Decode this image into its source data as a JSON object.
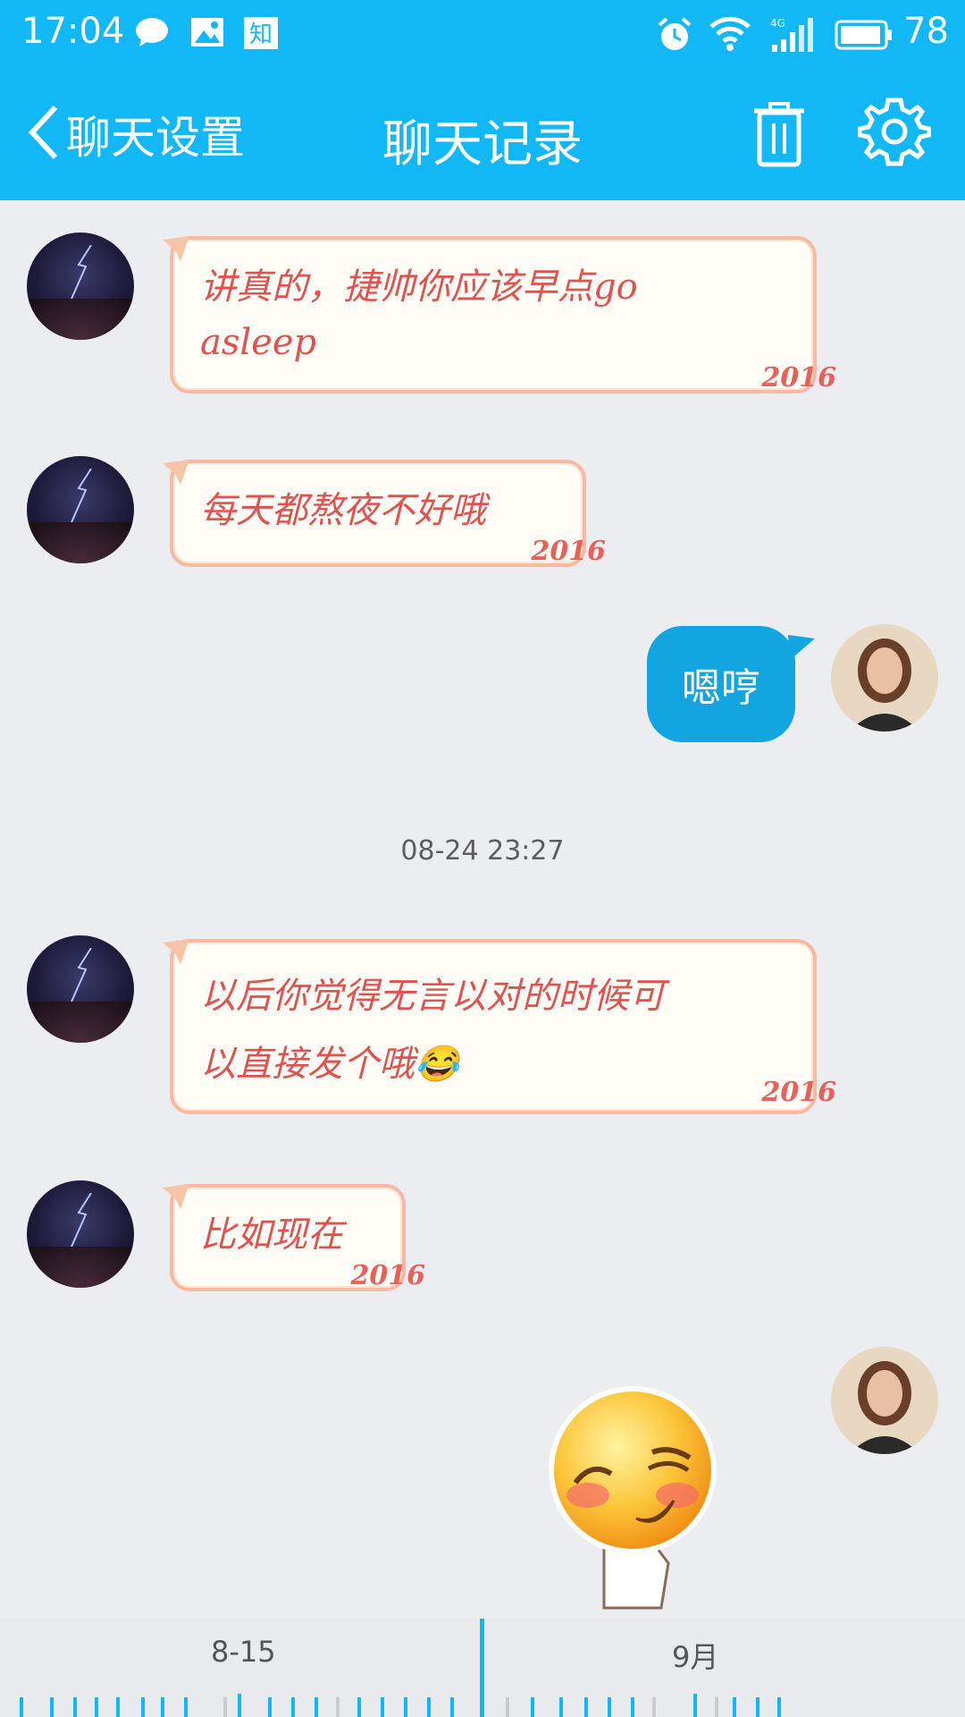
{
  "status_bar": {
    "time": "17:04",
    "battery": "78",
    "network": "4G"
  },
  "header": {
    "back_label": "聊天设置",
    "title": "聊天记录"
  },
  "messages": [
    {
      "side": "left",
      "text_line1": "讲真的，捷帅你应该早点go",
      "text_line2": "asleep",
      "badge": "2016"
    },
    {
      "side": "left",
      "text": "每天都熬夜不好哦",
      "badge": "2016"
    },
    {
      "side": "right",
      "text": "嗯哼"
    },
    {
      "side": "left",
      "text_line1": "以后你觉得无言以对的时候可",
      "text_line2": "以直接发个哦😂",
      "badge": "2016"
    },
    {
      "side": "left",
      "text": "比如现在",
      "badge": "2016"
    },
    {
      "side": "right",
      "sticker": "blushing-smile-emoji"
    }
  ],
  "timestamp": "08-24 23:27",
  "timeline": {
    "label_left": "8-15",
    "label_right": "9月"
  },
  "colors": {
    "header": "#12b7f5",
    "blue_bubble": "#12a5df",
    "card_text": "#e0524f"
  }
}
